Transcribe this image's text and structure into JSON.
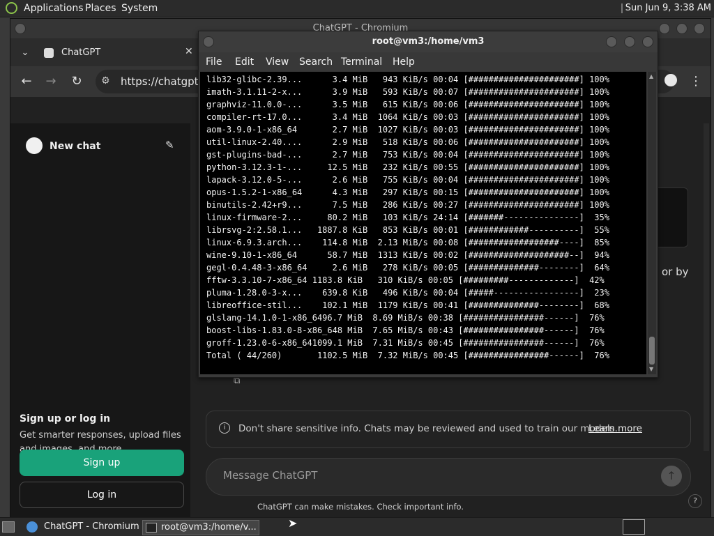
{
  "top_panel": {
    "menus": [
      "Applications",
      "Places",
      "System"
    ],
    "clock": "Sun Jun  9, 3:38 AM"
  },
  "chromium": {
    "window_title": "ChatGPT - Chromium",
    "tab_title": "ChatGPT",
    "url": "https://chatgpt.co"
  },
  "chatgpt": {
    "new_chat": "New chat",
    "signup_heading": "Sign up or log in",
    "signup_desc_1": "Get smarter responses, upload files",
    "signup_desc_2": "and images, and more.",
    "signup_button": "Sign up",
    "login_button": "Log in",
    "partial_text": "or by",
    "notice_text": "Don't share sensitive info. Chats may be reviewed and used to train our models.",
    "learn_more": "Learn more",
    "composer_placeholder": "Message ChatGPT",
    "footer": "ChatGPT can make mistakes. Check important info.",
    "help": "?"
  },
  "terminal": {
    "title": "root@vm3:/home/vm3",
    "menus": [
      "File",
      "Edit",
      "View",
      "Search",
      "Terminal",
      "Help"
    ],
    "lines": [
      "lib32-glibc-2.39...      3.4 MiB   943 KiB/s 00:04 [######################] 100%",
      "imath-3.1.11-2-x...      3.9 MiB   593 KiB/s 00:07 [######################] 100%",
      "graphviz-11.0.0-...      3.5 MiB   615 KiB/s 00:06 [######################] 100%",
      "compiler-rt-17.0...      3.4 MiB  1064 KiB/s 00:03 [######################] 100%",
      "aom-3.9.0-1-x86_64       2.7 MiB  1027 KiB/s 00:03 [######################] 100%",
      "util-linux-2.40....      2.9 MiB   518 KiB/s 00:06 [######################] 100%",
      "gst-plugins-bad-...      2.7 MiB   753 KiB/s 00:04 [######################] 100%",
      "python-3.12.3-1-...     12.5 MiB   232 KiB/s 00:55 [######################] 100%",
      "lapack-3.12.0-5-...      2.6 MiB   755 KiB/s 00:04 [######################] 100%",
      "opus-1.5.2-1-x86_64      4.3 MiB   297 KiB/s 00:15 [######################] 100%",
      "binutils-2.42+r9...      7.5 MiB   286 KiB/s 00:27 [######################] 100%",
      "linux-firmware-2...     80.2 MiB   103 KiB/s 24:14 [#######---------------]  35%",
      "librsvg-2:2.58.1...   1887.8 KiB   853 KiB/s 00:01 [############----------]  55%",
      "linux-6.9.3.arch...    114.8 MiB  2.13 MiB/s 00:08 [##################----]  85%",
      "wine-9.10-1-x86_64      58.7 MiB  1313 KiB/s 00:02 [####################--]  94%",
      "gegl-0.4.48-3-x86_64     2.6 MiB   278 KiB/s 00:05 [##############--------]  64%",
      "fftw-3.3.10-7-x86_64 1183.8 KiB   310 KiB/s 00:05 [#########-------------]  42%",
      "pluma-1.28.0-3-x...    639.8 KiB   496 KiB/s 00:04 [#####-----------------]  23%",
      "libreoffice-stil...    102.1 MiB  1179 KiB/s 00:41 [##############--------]  68%",
      "glslang-14.1.0-1-x86_6496.7 MiB  8.69 MiB/s 00:38 [################------]  76%",
      "boost-libs-1.83.0-8-x86_648 MiB  7.65 MiB/s 00:43 [################------]  76%",
      "groff-1.23.0-6-x86_641099.1 MiB  7.31 MiB/s 00:45 [################------]  76%",
      "Total ( 44/260)       1102.5 MiB  7.32 MiB/s 00:45 [################------]  76%"
    ]
  },
  "taskbar": {
    "chromium_task": "ChatGPT - Chromium",
    "terminal_task": "root@vm3:/home/v..."
  },
  "colors": {
    "accent_green": "#19a27a",
    "terminal_bg": "#000000"
  }
}
